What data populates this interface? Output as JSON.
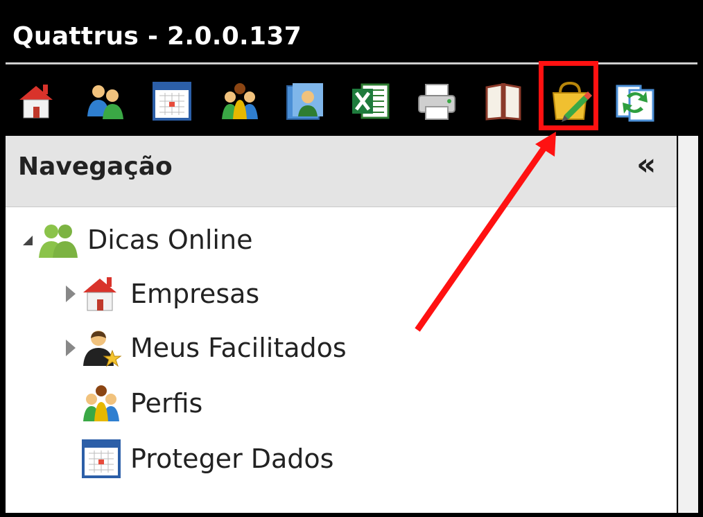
{
  "window": {
    "title": "Quattrus - 2.0.0.137"
  },
  "toolbar": {
    "buttons": [
      {
        "icon": "house-icon"
      },
      {
        "icon": "users-icon"
      },
      {
        "icon": "calendar-icon"
      },
      {
        "icon": "group-icon"
      },
      {
        "icon": "contact-folder-icon"
      },
      {
        "icon": "excel-icon"
      },
      {
        "icon": "printer-icon"
      },
      {
        "icon": "book-icon"
      },
      {
        "icon": "bag-pencil-icon"
      },
      {
        "icon": "sync-icon"
      }
    ],
    "highlighted_button_index": 8
  },
  "navigation": {
    "title": "Navegação",
    "collapse_glyph": "«",
    "tree": {
      "root": {
        "label": "Dicas Online",
        "expanded": true,
        "icon": "group-green-icon"
      },
      "children": [
        {
          "label": "Empresas",
          "expandable": true,
          "icon": "house-icon"
        },
        {
          "label": "Meus Facilitados",
          "expandable": true,
          "icon": "user-star-icon"
        },
        {
          "label": "Perfis",
          "expandable": false,
          "icon": "profiles-icon"
        },
        {
          "label": "Proteger Dados",
          "expandable": false,
          "icon": "calendar-icon"
        }
      ]
    }
  },
  "annotation": {
    "color": "#ff1111"
  }
}
